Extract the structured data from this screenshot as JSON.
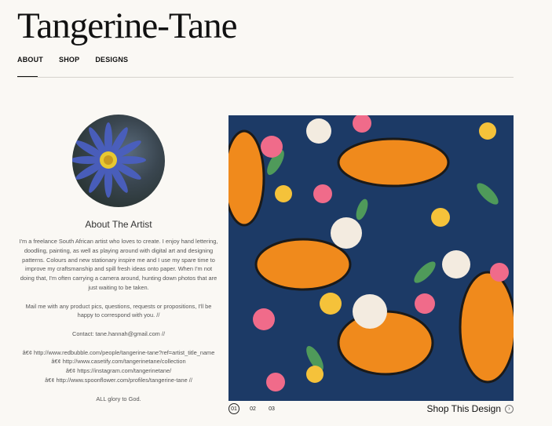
{
  "site": {
    "title": "Tangerine-Tane"
  },
  "nav": {
    "items": [
      "ABOUT",
      "SHOP",
      "DESIGNS"
    ]
  },
  "about": {
    "title": "About The Artist",
    "paragraphs": [
      "I'm a freelance South African artist who loves to create. I enjoy hand lettering, doodling, painting, as well as playing around with digital art and designing patterns. Colours and new stationary inspire me and I use my spare time to improve my craftsmanship and spill fresh ideas onto paper. When I'm not doing that, I'm often carrying a camera around, hunting down photos that are just waiting to be taken.",
      "Mail me with any product pics, questions, requests or propositions, I'll be happy to correspond with you. //",
      "Contact: tane.hannah@gmail.com //",
      "â€¢ http://www.redbubble.com/people/tangerine-tane?ref=artist_title_name\nâ€¢ http://www.casetify.com/tangerinetane/collection\nâ€¢ https://instagram.com/tangerinetane/\nâ€¢ http://www.spoonflower.com/profiles/tangerine-tane //",
      "ALL glory to God."
    ]
  },
  "pager": {
    "pages": [
      "01",
      "02",
      "03"
    ]
  },
  "shop": {
    "label": "Shop This Design",
    "arrow": "›"
  },
  "colors": {
    "hero_bg": "#1c3a66",
    "tiger": "#f08a1c",
    "flower_pink": "#f06b8a",
    "flower_yellow": "#f5c23a"
  }
}
